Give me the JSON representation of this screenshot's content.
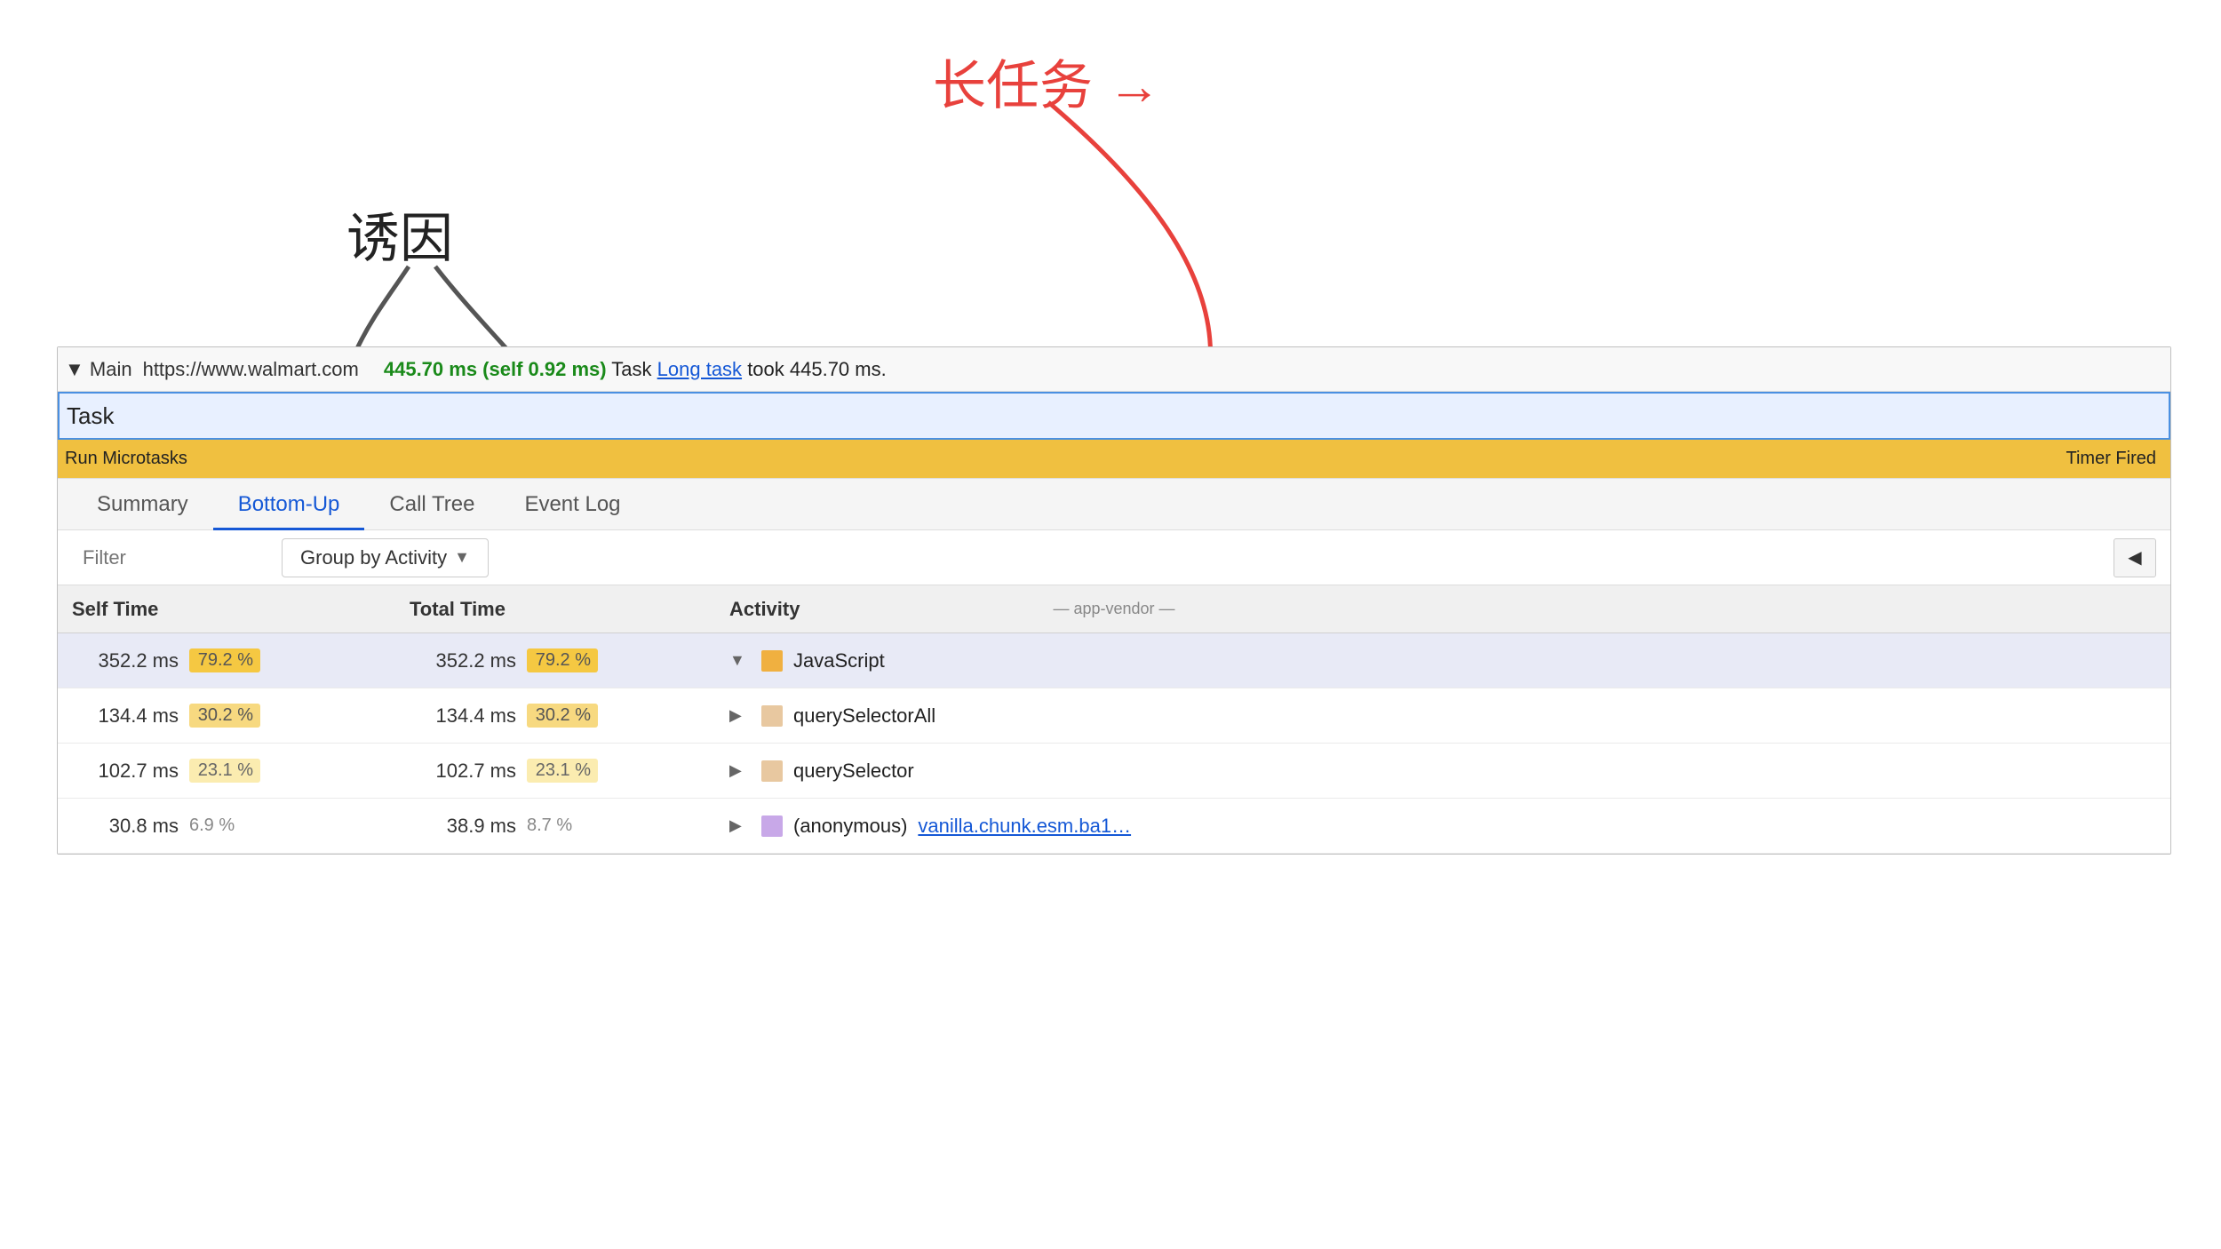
{
  "annotations": {
    "label_long_task": "长任务 →",
    "label_trigger": "诱因"
  },
  "timeline": {
    "section_label": "▼ Main",
    "url": "https://www.walmart.com",
    "timing_text": "445.70 ms (self 0.92 ms)",
    "task_description": "Task",
    "long_task_label": "Long task",
    "long_task_suffix": "took 445.70 ms.",
    "task_bar_label": "Task",
    "subtask_left": "Run Microtasks",
    "subtask_right": "Timer Fired"
  },
  "tabs": [
    {
      "id": "summary",
      "label": "Summary",
      "active": false
    },
    {
      "id": "bottom-up",
      "label": "Bottom-Up",
      "active": true
    },
    {
      "id": "call-tree",
      "label": "Call Tree",
      "active": false
    },
    {
      "id": "event-log",
      "label": "Event Log",
      "active": false
    }
  ],
  "filter": {
    "placeholder": "Filter",
    "group_by_label": "Group by Activity",
    "sidebar_toggle_icon": "◀"
  },
  "table": {
    "headers": {
      "self_time": "Self Time",
      "total_time": "Total Time",
      "activity": "Activity",
      "waterfall": "— app-vendor —"
    },
    "rows": [
      {
        "self_time_val": "352.2 ms",
        "self_time_pct": "79.2 %",
        "self_time_pct_class": "high",
        "total_time_val": "352.2 ms",
        "total_time_pct": "79.2 %",
        "total_time_pct_class": "high",
        "expand": "▼",
        "color": "#f0b040",
        "activity_name": "JavaScript",
        "activity_link": null,
        "highlighted": true
      },
      {
        "self_time_val": "134.4 ms",
        "self_time_pct": "30.2 %",
        "self_time_pct_class": "med",
        "total_time_val": "134.4 ms",
        "total_time_pct": "30.2 %",
        "total_time_pct_class": "med",
        "expand": "▶",
        "color": "#e8c8a0",
        "activity_name": "querySelectorAll",
        "activity_link": null,
        "highlighted": false
      },
      {
        "self_time_val": "102.7 ms",
        "self_time_pct": "23.1 %",
        "self_time_pct_class": "low",
        "total_time_val": "102.7 ms",
        "total_time_pct": "23.1 %",
        "total_time_pct_class": "low",
        "expand": "▶",
        "color": "#e8c8a0",
        "activity_name": "querySelector",
        "activity_link": null,
        "highlighted": false
      },
      {
        "self_time_val": "30.8 ms",
        "self_time_pct": "6.9 %",
        "self_time_pct_class": "plain",
        "total_time_val": "38.9 ms",
        "total_time_pct": "8.7 %",
        "total_time_pct_class": "plain",
        "expand": "▶",
        "color": "#c8a8e8",
        "activity_name": "(anonymous)",
        "activity_link": "vanilla.chunk.esm.ba1…",
        "highlighted": false
      }
    ]
  }
}
